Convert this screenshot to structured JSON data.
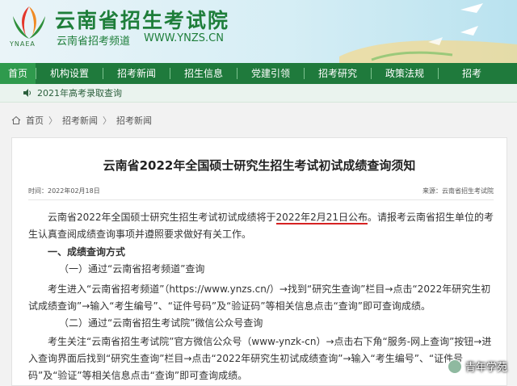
{
  "header": {
    "site_title": "云南省招生考试院",
    "site_subtitle": "云南省招考频道",
    "site_url": "WWW.YNZS.CN",
    "logo_caption": "YNAEA"
  },
  "nav": {
    "items": [
      "首页",
      "机构设置",
      "招考新闻",
      "招生信息",
      "党建引领",
      "招考研究",
      "政策法规",
      "招考"
    ]
  },
  "ticker": {
    "text": "2021年高考录取查询"
  },
  "breadcrumb": {
    "items": [
      "首页",
      "招考新闻",
      "招考新闻"
    ],
    "separator": "〉"
  },
  "article": {
    "title": "云南省2022年全国硕士研究生招生考试初试成绩查询须知",
    "date": "时间：2022年02月18日",
    "source": "来源：云南省招生考试院",
    "intro_before": "云南省2022年全国硕士研究生招生考试初试成绩将于",
    "intro_highlight": "2022年2月21日公布",
    "intro_after": "。请报考云南省招生单位的考生认真查阅成绩查询事项并遵照要求做好有关工作。",
    "section1": "一、成绩查询方式",
    "method1": "（一）通过“云南省招考频道”查询",
    "method1_text": "考生进入“云南省招考频道”（https://www.ynzs.cn/）→找到“研究生查询”栏目→点击“2022年研究生初试成绩查询”→输入“考生编号”、“证件号码”及“验证码”等相关信息点击“查询”即可查询成绩。",
    "method2": "（二）通过“云南省招生考试院”微信公众号查询",
    "method2_text": "考生关注“云南省招生考试院”官方微信公众号（www-ynzk-cn）→点击右下角“服务-网上查询”按钮→进入查询界面后找到“研究生查询”栏目→点击“2022年研究生初试成绩查询”→输入“考生编号”、“证件号码”及“验证”等相关信息点击“查询”即可查询成绩。"
  },
  "watermark": {
    "text": "青年学苑"
  },
  "colors": {
    "brand_green": "#1f7a3c",
    "highlight_red": "#d62222"
  }
}
